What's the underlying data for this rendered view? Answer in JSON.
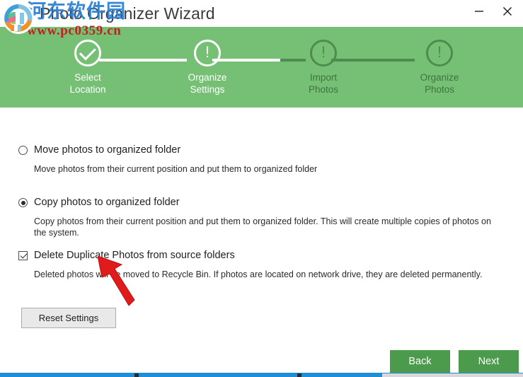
{
  "window": {
    "title": "Photo Organizer Wizard",
    "logo_icon": "photo-organizer-logo-icon",
    "minimize_glyph": "—",
    "close_glyph": "✕",
    "minimize_name": "minimize-icon",
    "close_name": "close-icon"
  },
  "watermark": {
    "site_name": "河东软件园",
    "url": "www.pc0359.cn",
    "site_color": "#2a7fd4",
    "url_color": "#c31f1f"
  },
  "stepper": {
    "accent_bg": "#76c076",
    "active_color": "#ffffff",
    "inactive_color": "#4e8b4e",
    "steps": [
      {
        "label": "Select\nLocation",
        "state": "done",
        "icon": "check-icon"
      },
      {
        "label": "Organize\nSettings",
        "state": "active",
        "icon": "exclamation-icon"
      },
      {
        "label": "Import\nPhotos",
        "state": "todo",
        "icon": "exclamation-icon"
      },
      {
        "label": "Organize\nPhotos",
        "state": "todo",
        "icon": "exclamation-icon"
      }
    ]
  },
  "options": {
    "move": {
      "label": "Move photos to organized folder",
      "description": "Move photos from their current position and put them to organized folder",
      "selected": false
    },
    "copy": {
      "label": "Copy photos to organized folder",
      "description": "Copy photos from their current position and put them to organized folder. This will create multiple copies of photos on the system.",
      "selected": true
    },
    "delete_duplicates": {
      "label": "Delete Duplicate Photos from source folders",
      "description": "Deleted photos will be moved to Recycle Bin. If photos are located on network drive, they are deleted permanently.",
      "checked": true
    }
  },
  "buttons": {
    "reset": "Reset Settings",
    "back": "Back",
    "next": "Next",
    "nav_color": "#4c9a4c"
  },
  "annotation": {
    "arrow_color": "#e01b1b",
    "arrow_name": "red-pointer-arrow"
  }
}
